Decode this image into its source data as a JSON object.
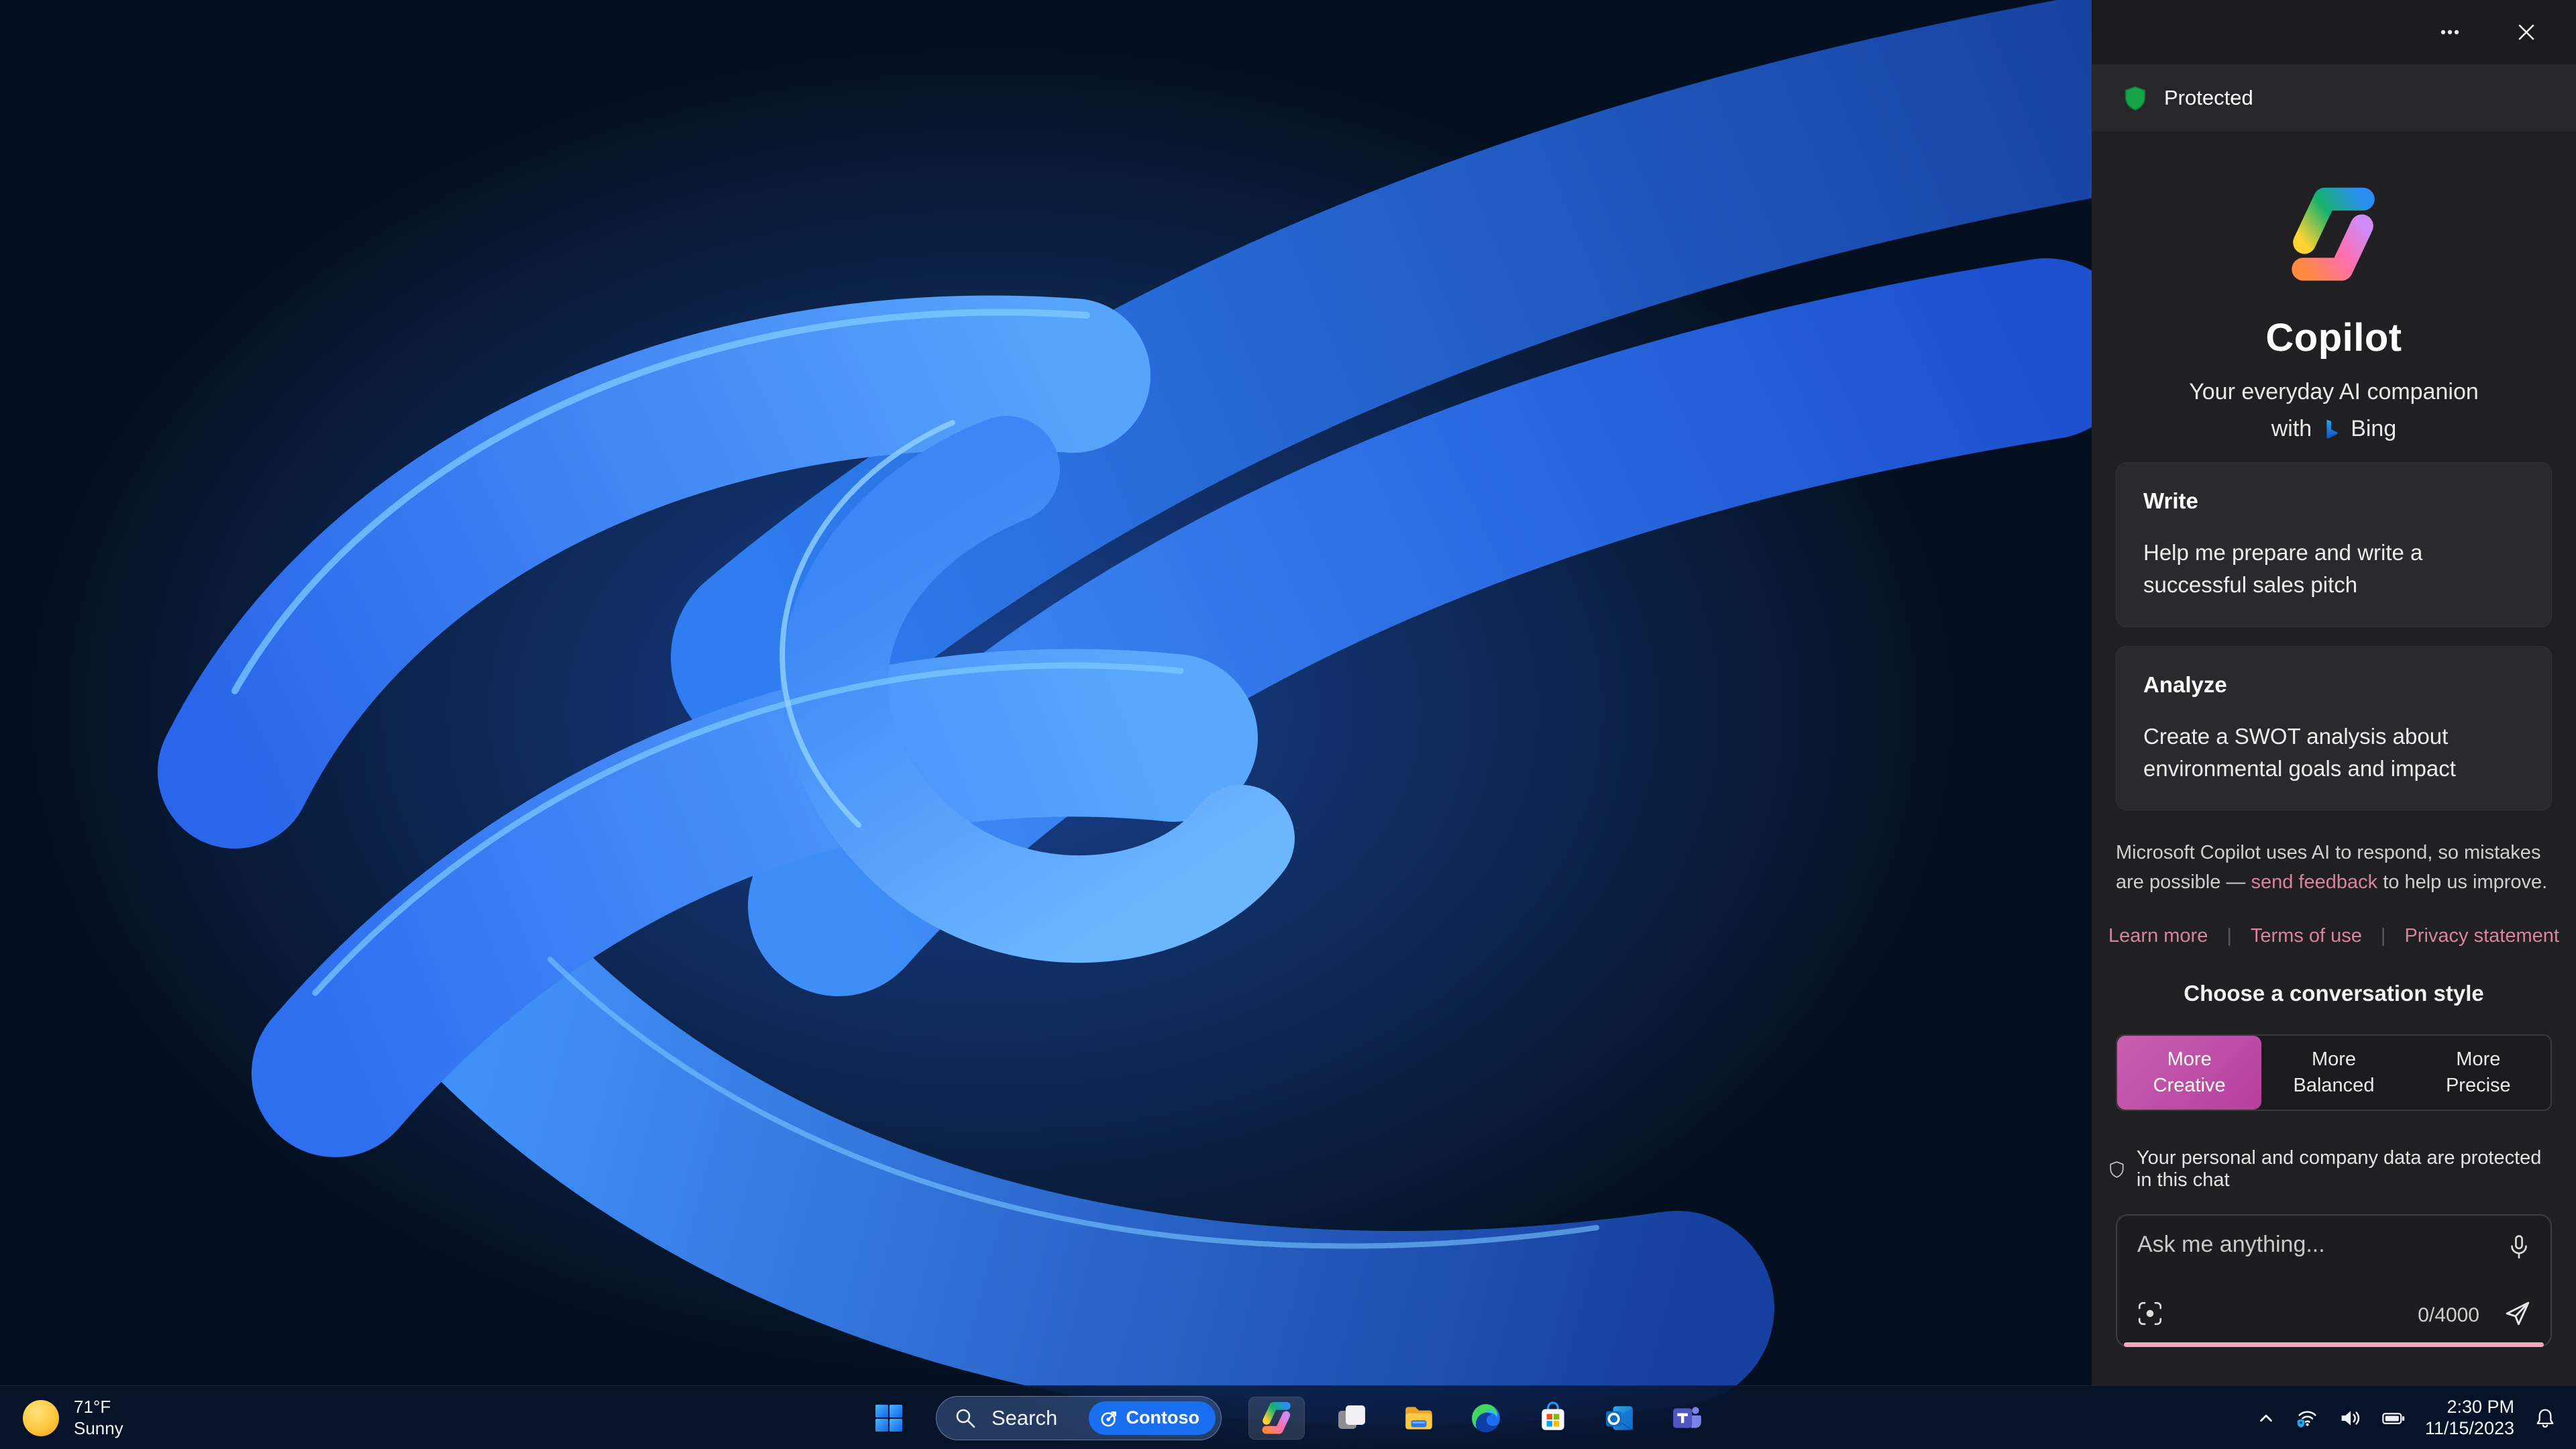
{
  "panel": {
    "protected_label": "Protected",
    "brand": {
      "title": "Copilot",
      "subtitle": "Your everyday AI companion",
      "with_prefix": "with",
      "bing_label": "Bing"
    },
    "cards": [
      {
        "title": "Write",
        "body": "Help me prepare and write a successful sales pitch"
      },
      {
        "title": "Analyze",
        "body": "Create a SWOT analysis about environmental goals and impact"
      }
    ],
    "disclaimer": {
      "before": "Microsoft Copilot uses AI to respond, so mistakes are possible — ",
      "link": "send feedback",
      "after": " to help us improve."
    },
    "links": [
      "Learn more",
      "Terms of use",
      "Privacy statement"
    ],
    "style_chooser": {
      "heading": "Choose a conversation style",
      "options": [
        {
          "line1": "More",
          "line2": "Creative",
          "selected": true
        },
        {
          "line1": "More",
          "line2": "Balanced",
          "selected": false
        },
        {
          "line1": "More",
          "line2": "Precise",
          "selected": false
        }
      ]
    },
    "privacy_note": "Your personal and company data are protected in this chat",
    "input": {
      "placeholder": "Ask me anything...",
      "value": "",
      "counter": "0/4000"
    }
  },
  "taskbar": {
    "weather": {
      "temp": "71°F",
      "condition": "Sunny"
    },
    "search": {
      "label": "Search",
      "badge": "Contoso"
    },
    "apps": [
      "start",
      "search",
      "copilot",
      "task-view",
      "file-explorer",
      "edge",
      "microsoft-store",
      "outlook",
      "teams"
    ],
    "tray": {
      "time": "2:30 PM",
      "date": "11/15/2023"
    }
  },
  "icons": {
    "panel": [
      "more-icon",
      "close-icon",
      "shield-icon",
      "copilot-logo",
      "bing-logo",
      "shield-outline-icon",
      "mic-icon",
      "visual-search-icon",
      "send-icon"
    ],
    "taskbar": [
      "sun-icon",
      "start-icon",
      "search-icon",
      "contoso-target-icon",
      "copilot-icon",
      "task-view-icon",
      "file-explorer-icon",
      "edge-icon",
      "store-icon",
      "outlook-icon",
      "teams-icon",
      "chevron-up-icon",
      "wifi-shield-icon",
      "volume-icon",
      "battery-icon",
      "bell-icon"
    ]
  },
  "colors": {
    "panel_bg": "#202022",
    "header_bg": "#1b1b1d",
    "protected_bar_bg": "#27272a",
    "card_bg": "#2a2a2d",
    "link_pink": "#d9849e",
    "selected_style_magenta": "#bf4fa3",
    "input_underline_pink": "#f4a8bc",
    "shield_green": "#16a34a",
    "taskbar_bg": "#0d1c33",
    "contoso_blue": "#1a6ff0",
    "wallpaper_blue": "#2a6bf0"
  }
}
